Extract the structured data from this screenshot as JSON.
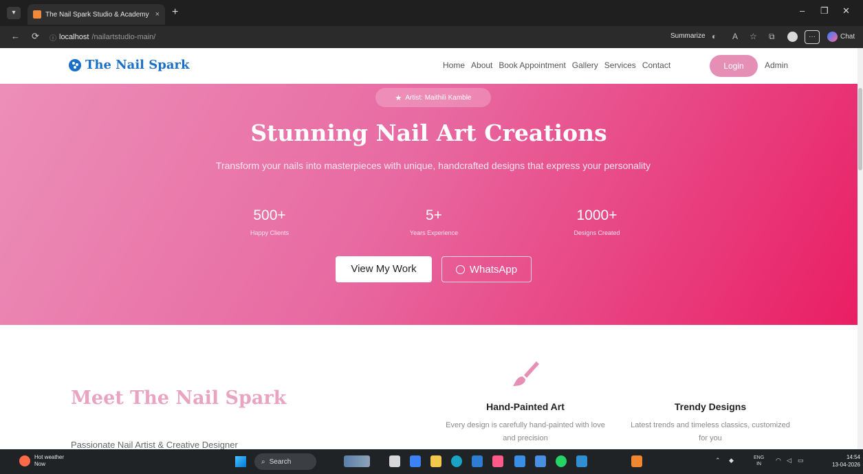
{
  "browser": {
    "tab_title": "The Nail Spark Studio & Academy",
    "tab_close": "×",
    "new_tab": "+",
    "url_host": "localhost",
    "url_path": "/nailartstudio-main/",
    "summarize_label": "Summarize",
    "copilot_label": "Chat",
    "more_label": "···"
  },
  "header": {
    "brand": "The Nail Spark",
    "nav": [
      "Home",
      "About",
      "Book Appointment",
      "Gallery",
      "Services",
      "Contact"
    ],
    "login": "Login",
    "admin": "Admin"
  },
  "hero": {
    "badge": "Artist: Maithili Kamble",
    "title": "Stunning Nail Art Creations",
    "subtitle": "Transform your nails into masterpieces with unique, handcrafted designs that express your personality",
    "stats": [
      {
        "value": "500+",
        "label": "Happy Clients"
      },
      {
        "value": "5+",
        "label": "Years Experience"
      },
      {
        "value": "1000+",
        "label": "Designs Created"
      }
    ],
    "primary_button": "View My Work",
    "whatsapp_button": "WhatsApp"
  },
  "meet": {
    "title": "Meet The Nail Spark",
    "subtitle": "Passionate Nail Artist & Creative Designer"
  },
  "features": [
    {
      "title": "Hand-Painted Art",
      "desc": "Every design is carefully hand-painted with love and precision"
    },
    {
      "title": "Trendy Designs",
      "desc": "Latest trends and timeless classics, customized for you"
    }
  ],
  "taskbar": {
    "weather_title": "Hot weather",
    "weather_sub": "Now",
    "search": "Search",
    "lang_top": "ENG",
    "lang_bottom": "IN",
    "time": "14:54",
    "date": "13-04-2026"
  },
  "colors": {
    "brand_blue": "#1a6fc9",
    "hero_start": "#ec8fb8",
    "hero_end": "#e91e63",
    "meet_title": "#e9a4c1"
  }
}
